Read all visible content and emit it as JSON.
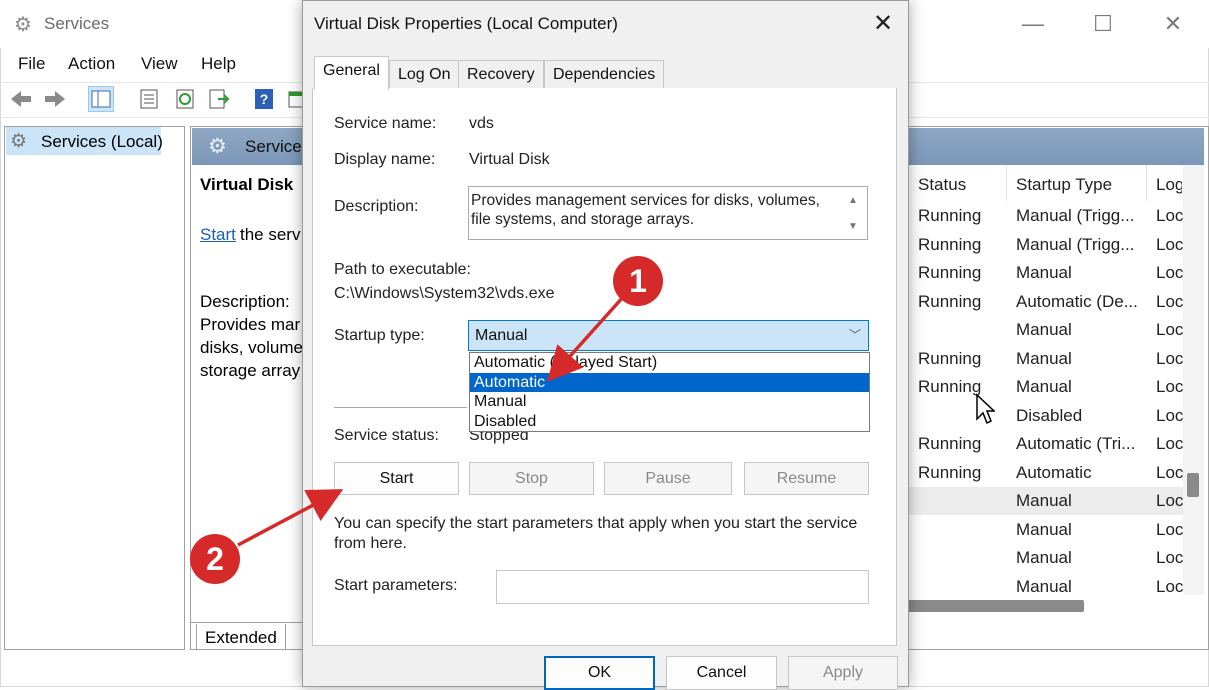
{
  "services_window": {
    "title": "Services",
    "menu": [
      "File",
      "Action",
      "View",
      "Help"
    ],
    "tree_item": "Services (Local)",
    "header_label": "Service",
    "selected_service_title": "Virtual Disk",
    "start_link": "Start",
    "start_rest": "the serv",
    "description_label": "Description:",
    "description_lines": [
      "Provides mar",
      "disks, volume",
      "storage array"
    ],
    "bottom_tab": "Extended",
    "columns": [
      "Status",
      "Startup Type",
      "Log"
    ],
    "rows": [
      {
        "status": "Running",
        "startup": "Manual (Trigg...",
        "log": "Loc"
      },
      {
        "status": "Running",
        "startup": "Manual (Trigg...",
        "log": "Loc"
      },
      {
        "status": "Running",
        "startup": "Manual",
        "log": "Loc"
      },
      {
        "status": "Running",
        "startup": "Automatic (De...",
        "log": "Loc"
      },
      {
        "status": "",
        "startup": "Manual",
        "log": "Loc"
      },
      {
        "status": "Running",
        "startup": "Manual",
        "log": "Loc"
      },
      {
        "status": "Running",
        "startup": "Manual",
        "log": "Loc"
      },
      {
        "status": "",
        "startup": "Disabled",
        "log": "Loc"
      },
      {
        "status": "Running",
        "startup": "Automatic (Tri...",
        "log": "Loc"
      },
      {
        "status": "Running",
        "startup": "Automatic",
        "log": "Loc"
      },
      {
        "status": "",
        "startup": "Manual",
        "log": "Loc"
      },
      {
        "status": "",
        "startup": "Manual",
        "log": "Loc"
      },
      {
        "status": "",
        "startup": "Manual",
        "log": "Loc"
      },
      {
        "status": "",
        "startup": "Manual",
        "log": "Loc"
      }
    ]
  },
  "dialog": {
    "title": "Virtual Disk Properties (Local Computer)",
    "tabs": [
      "General",
      "Log On",
      "Recovery",
      "Dependencies"
    ],
    "service_name_label": "Service name:",
    "service_name": "vds",
    "display_name_label": "Display name:",
    "display_name": "Virtual Disk",
    "description_label": "Description:",
    "description": "Provides management services for disks, volumes, file systems, and storage arrays.",
    "path_label": "Path to executable:",
    "path": "C:\\Windows\\System32\\vds.exe",
    "startup_type_label": "Startup type:",
    "startup_type_value": "Manual",
    "startup_options": [
      "Automatic (Delayed Start)",
      "Automatic",
      "Manual",
      "Disabled"
    ],
    "highlighted_option": "Automatic",
    "service_status_label": "Service status:",
    "service_status": "Stopped",
    "buttons": {
      "start": "Start",
      "stop": "Stop",
      "pause": "Pause",
      "resume": "Resume"
    },
    "hint": "You can specify the start parameters that apply when you start the service from here.",
    "start_parameters_label": "Start parameters:",
    "start_parameters_value": "",
    "footer": {
      "ok": "OK",
      "cancel": "Cancel",
      "apply": "Apply"
    }
  },
  "annotations": {
    "badge1": "1",
    "badge2": "2",
    "color": "#d62a2a"
  }
}
